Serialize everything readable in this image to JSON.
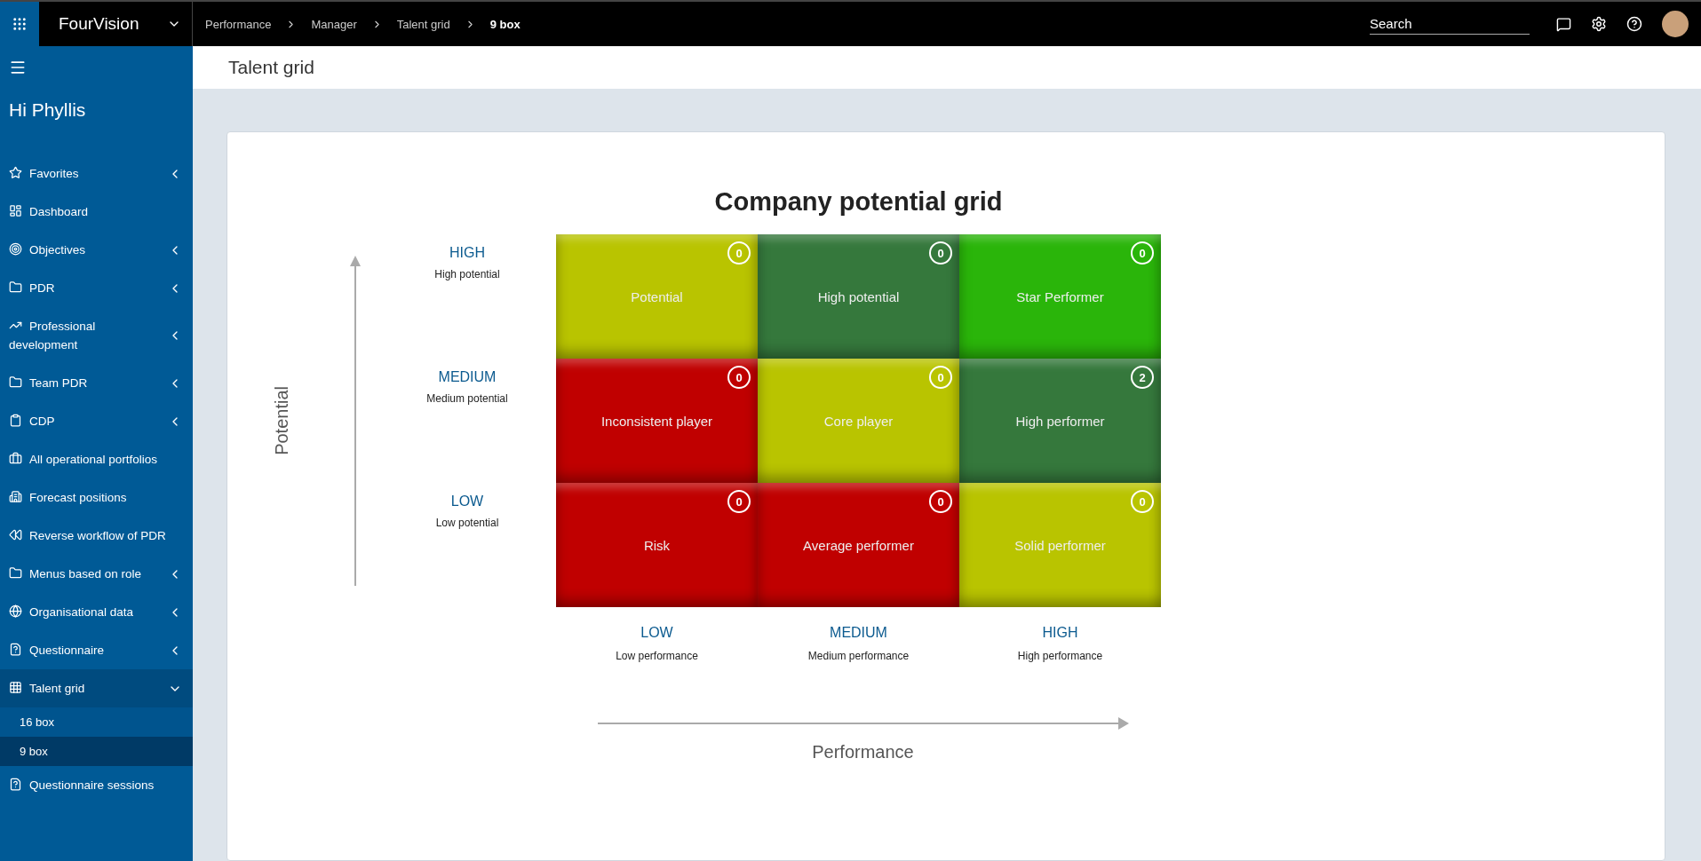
{
  "app": {
    "name": "FourVision"
  },
  "breadcrumb": [
    {
      "label": "Performance",
      "current": false
    },
    {
      "label": "Manager",
      "current": false
    },
    {
      "label": "Talent grid",
      "current": false
    },
    {
      "label": "9 box",
      "current": true
    }
  ],
  "search": {
    "placeholder": "Search"
  },
  "page": {
    "title": "Talent grid"
  },
  "sidebar": {
    "greeting": "Hi Phyllis",
    "items": [
      {
        "label": "Favorites",
        "submenu": true,
        "expanded": false
      },
      {
        "label": "Dashboard",
        "submenu": false,
        "expanded": false
      },
      {
        "label": "Objectives",
        "submenu": true,
        "expanded": false
      },
      {
        "label": "PDR",
        "submenu": true,
        "expanded": false
      },
      {
        "label": "Professional development",
        "submenu": true,
        "expanded": false
      },
      {
        "label": "Team PDR",
        "submenu": true,
        "expanded": false
      },
      {
        "label": "CDP",
        "submenu": true,
        "expanded": false
      },
      {
        "label": "All operational portfolios",
        "submenu": false,
        "expanded": false
      },
      {
        "label": "Forecast positions",
        "submenu": false,
        "expanded": false
      },
      {
        "label": "Reverse workflow of PDR",
        "submenu": false,
        "expanded": false
      },
      {
        "label": "Menus based on role",
        "submenu": true,
        "expanded": false
      },
      {
        "label": "Organisational data",
        "submenu": true,
        "expanded": false
      },
      {
        "label": "Questionnaire",
        "submenu": true,
        "expanded": false
      },
      {
        "label": "Talent grid",
        "submenu": true,
        "expanded": true,
        "children": [
          {
            "label": "16 box",
            "selected": false
          },
          {
            "label": "9 box",
            "selected": true
          }
        ]
      },
      {
        "label": "Questionnaire sessions",
        "submenu": false,
        "expanded": false
      }
    ]
  },
  "grid": {
    "title": "Company potential grid",
    "y_axis": "Potential",
    "x_axis": "Performance",
    "rows": [
      {
        "level": "HIGH",
        "sub": "High potential"
      },
      {
        "level": "MEDIUM",
        "sub": "Medium potential"
      },
      {
        "level": "LOW",
        "sub": "Low potential"
      }
    ],
    "columns": [
      {
        "level": "LOW",
        "sub": "Low performance"
      },
      {
        "level": "MEDIUM",
        "sub": "Medium performance"
      },
      {
        "level": "HIGH",
        "sub": "High performance"
      }
    ],
    "cells": [
      {
        "label": "Potential",
        "count": "0",
        "color": "#b9c400"
      },
      {
        "label": "High potential",
        "count": "0",
        "color": "#35783c"
      },
      {
        "label": "Star Performer",
        "count": "0",
        "color": "#2ab50a"
      },
      {
        "label": "Inconsistent player",
        "count": "0",
        "color": "#c00000"
      },
      {
        "label": "Core player",
        "count": "0",
        "color": "#b9c400"
      },
      {
        "label": "High performer",
        "count": "2",
        "color": "#35783c"
      },
      {
        "label": "Risk",
        "count": "0",
        "color": "#c00000"
      },
      {
        "label": "Average performer",
        "count": "0",
        "color": "#c00000"
      },
      {
        "label": "Solid performer",
        "count": "0",
        "color": "#b9c400"
      }
    ]
  }
}
